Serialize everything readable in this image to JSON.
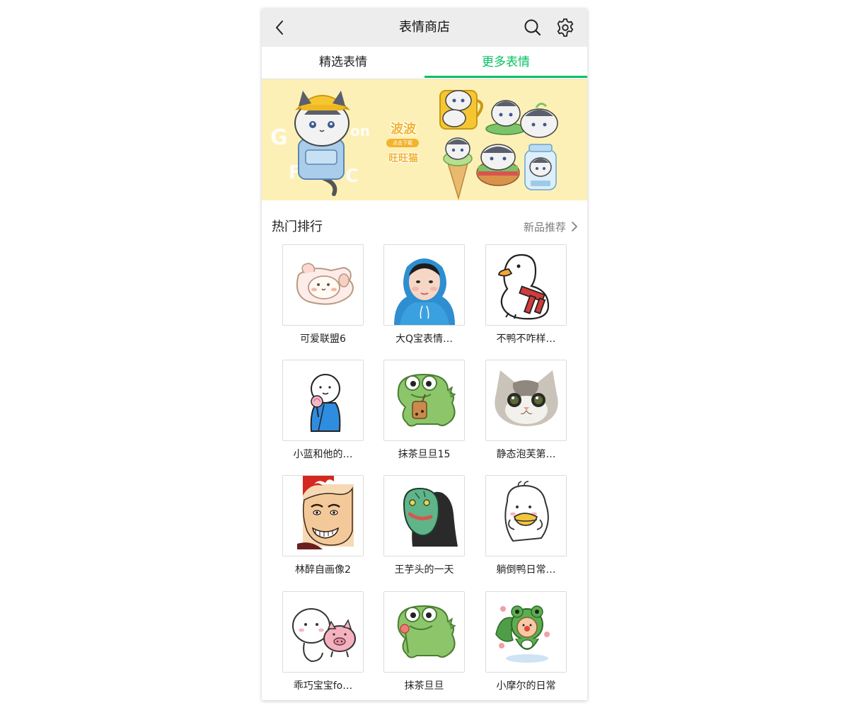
{
  "header": {
    "title": "表情商店",
    "back_icon": "chevron-left-icon",
    "search_icon": "search-icon",
    "settings_icon": "gear-icon"
  },
  "tabs": [
    {
      "label": "精选表情",
      "active": false
    },
    {
      "label": "更多表情",
      "active": true
    }
  ],
  "banner": {
    "title": "波波",
    "subtitle": "点击下载",
    "name": "旺旺猫"
  },
  "section": {
    "title": "热门排行",
    "link": "新品推荐"
  },
  "stickers": [
    {
      "name": "可爱联盟6",
      "icon": "bunny-sticker-icon"
    },
    {
      "name": "大Q宝表情…",
      "icon": "child-photo-icon"
    },
    {
      "name": "不鸭不咋样…",
      "icon": "duck-sticker-icon"
    },
    {
      "name": "小蓝和他的…",
      "icon": "blue-boy-icon"
    },
    {
      "name": "抹茶旦旦15",
      "icon": "green-dino-icon"
    },
    {
      "name": "静态泡芙第…",
      "icon": "cat-photo-icon"
    },
    {
      "name": "林醉自画像2",
      "icon": "face-drawing-icon"
    },
    {
      "name": "王芋头的一天",
      "icon": "mask-face-icon"
    },
    {
      "name": "躺倒鸭日常…",
      "icon": "lying-duck-icon"
    },
    {
      "name": "乖巧宝宝fo…",
      "icon": "baby-pig-icon"
    },
    {
      "name": "抹茶旦旦",
      "icon": "green-dino-flower-icon"
    },
    {
      "name": "小摩尔的日常",
      "icon": "frog-hood-icon"
    }
  ],
  "colors": {
    "accent": "#07c160",
    "header_bg": "#ededed",
    "banner_bg": "#fdf0b6"
  }
}
